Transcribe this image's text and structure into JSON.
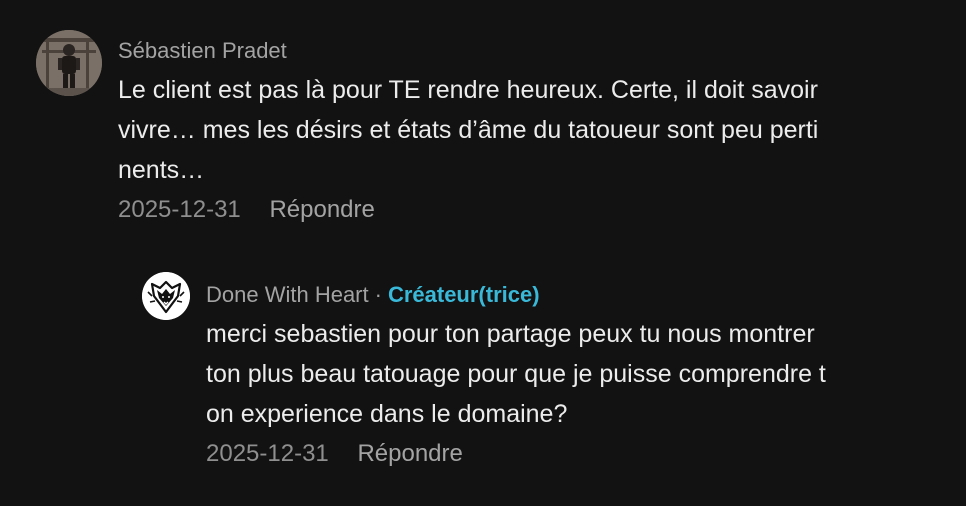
{
  "comments": [
    {
      "author": "Sébastien Pradet",
      "avatar": "user-photo-avatar",
      "text": "Le client est pas là pour TE rendre heureux. Certe, il doit savoir\nvivre… mes les désirs et états d’âme du tatoueur sont peu perti\nnents…",
      "date": "2025-12-31",
      "reply_label": "Répondre"
    }
  ],
  "reply": {
    "author": "Done With Heart",
    "separator": "·",
    "badge": "Créateur(trice)",
    "avatar": "wolf-logo-avatar",
    "text": "merci sebastien pour ton partage peux tu nous montrer\nton plus beau tatouage pour que je puisse comprendre t\non experience dans le domaine?",
    "date": "2025-12-31",
    "reply_label": "Répondre"
  },
  "colors": {
    "background": "#121212",
    "text": "#ececec",
    "secondary": "#a3a3a3",
    "creator_badge": "#3ab8d8"
  }
}
